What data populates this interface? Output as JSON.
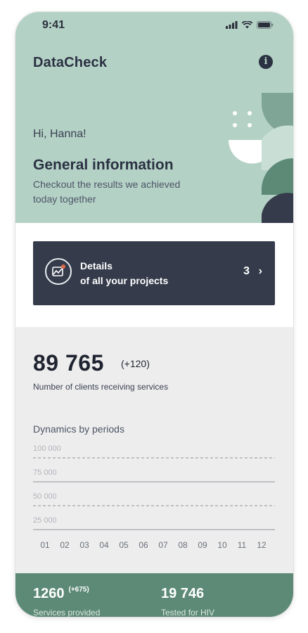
{
  "status_bar": {
    "time": "9:41"
  },
  "header": {
    "app_title": "DataCheck"
  },
  "hero": {
    "greeting": "Hi, Hanna!",
    "title": "General information",
    "subtitle": "Checkout the results we achieved today together"
  },
  "projects_card": {
    "line1": "Details",
    "line2": "of all your projects",
    "count": "3"
  },
  "summary": {
    "total": "89 765",
    "delta": "(+120)",
    "label": "Number of clients receiving services"
  },
  "dynamics": {
    "title": "Dynamics by periods"
  },
  "chart_data": {
    "type": "line",
    "title": "Dynamics by periods",
    "categories": [
      "01",
      "02",
      "03",
      "04",
      "05",
      "06",
      "07",
      "08",
      "09",
      "10",
      "11",
      "12"
    ],
    "y_ticks": [
      "100 000",
      "75 000",
      "50 000",
      "25 000"
    ],
    "ylim": [
      0,
      100000
    ],
    "grid": true
  },
  "footer": {
    "left": {
      "value": "1260",
      "delta": "(+675)",
      "label": "Services provided"
    },
    "right": {
      "value": "19 746",
      "label": "Tested for HIV"
    }
  },
  "colors": {
    "hero_bg": "#b4d1c6",
    "card_bg": "#353b4b",
    "stats_bg": "#ededed",
    "footer_bg": "#5d8a76"
  }
}
